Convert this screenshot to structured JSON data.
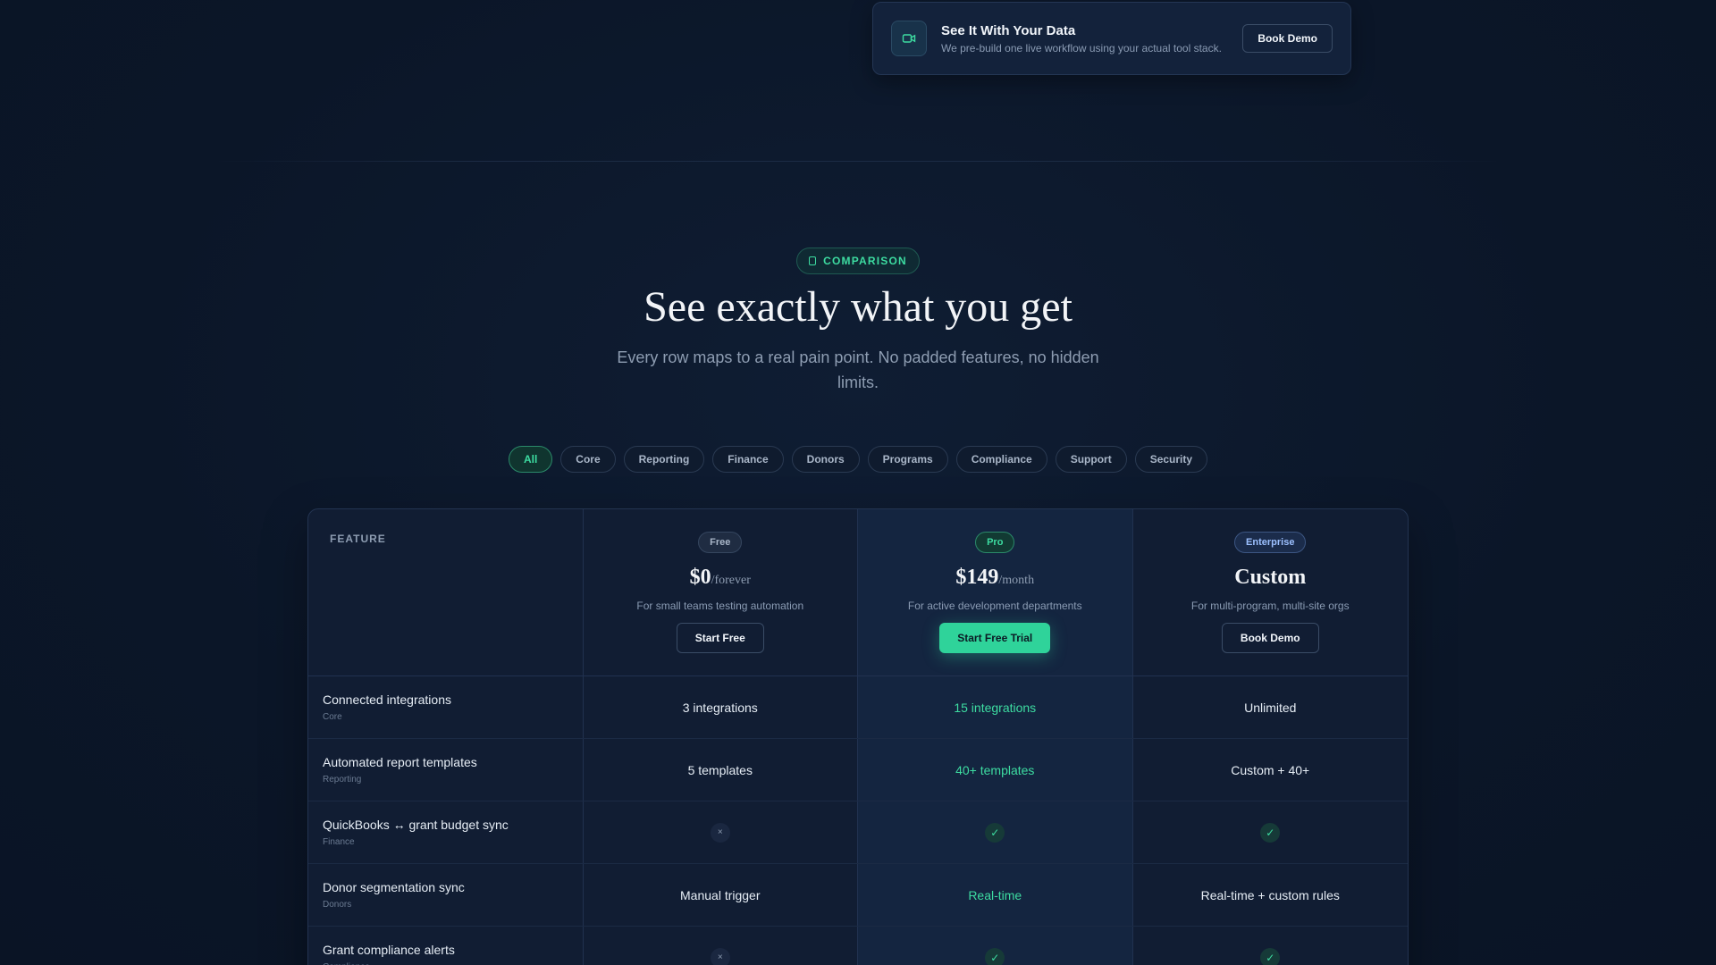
{
  "banner": {
    "title": "See It With Your Data",
    "subtitle": "We pre-build one live workflow using your actual tool stack.",
    "button": "Book Demo",
    "icon": "video-camera-icon"
  },
  "section": {
    "badge": "COMPARISON",
    "title": "See exactly what you get",
    "subtitle": "Every row maps to a real pain point. No padded features, no hidden limits."
  },
  "filters": [
    "All",
    "Core",
    "Reporting",
    "Finance",
    "Donors",
    "Programs",
    "Compliance",
    "Support",
    "Security"
  ],
  "active_filter": "All",
  "table": {
    "feature_header": "FEATURE",
    "plans": [
      {
        "tier": "Free",
        "price": "$0",
        "period": "/forever",
        "desc": "For small teams testing automation",
        "button": "Start Free"
      },
      {
        "tier": "Pro",
        "price": "$149",
        "period": "/month",
        "desc": "For active development departments",
        "button": "Start Free Trial"
      },
      {
        "tier": "Enterprise",
        "price": "Custom",
        "period": "",
        "desc": "For multi-program, multi-site orgs",
        "button": "Book Demo"
      }
    ],
    "rows": [
      {
        "name": "Connected integrations",
        "category": "Core",
        "values": [
          "3 integrations",
          "15 integrations",
          "Unlimited"
        ]
      },
      {
        "name": "Automated report templates",
        "category": "Reporting",
        "values": [
          "5 templates",
          "40+ templates",
          "Custom + 40+"
        ]
      },
      {
        "name": "QuickBooks ↔ grant budget sync",
        "category": "Finance",
        "values": [
          "×",
          "✓",
          "✓"
        ]
      },
      {
        "name": "Donor segmentation sync",
        "category": "Donors",
        "values": [
          "Manual trigger",
          "Real-time",
          "Real-time + custom rules"
        ]
      },
      {
        "name": "Grant compliance alerts",
        "category": "Compliance",
        "values": [
          "×",
          "✓",
          "✓"
        ]
      }
    ]
  },
  "colors": {
    "accent": "#2fd39a",
    "background": "#0b1628",
    "panel": "#111d33"
  }
}
